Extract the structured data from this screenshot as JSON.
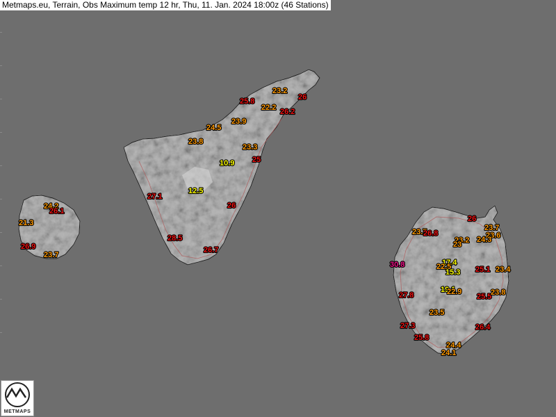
{
  "title": "Metmaps.eu, Terrain, Obs Maximum temp 12 hr, Thu, 11. Jan. 2024 18:00z (46 Stations)",
  "logo_text": "METMAPS",
  "colors": {
    "background": "#6e6e6e",
    "yellow": "#ffff00",
    "orange": "#ff9900",
    "red": "#ee1111",
    "magenta": "#ee1188"
  },
  "stations": [
    {
      "v": "23.2",
      "c": "orange"
    },
    {
      "v": "26",
      "c": "red"
    },
    {
      "v": "25.8",
      "c": "red"
    },
    {
      "v": "22.2",
      "c": "orange"
    },
    {
      "v": "26.2",
      "c": "red"
    },
    {
      "v": "24.5",
      "c": "orange"
    },
    {
      "v": "23.9",
      "c": "orange"
    },
    {
      "v": "23.8",
      "c": "orange"
    },
    {
      "v": "23.3",
      "c": "orange"
    },
    {
      "v": "10.9",
      "c": "yellow"
    },
    {
      "v": "25",
      "c": "red"
    },
    {
      "v": "12.5",
      "c": "yellow"
    },
    {
      "v": "27.1",
      "c": "red"
    },
    {
      "v": "26",
      "c": "red"
    },
    {
      "v": "28.5",
      "c": "red"
    },
    {
      "v": "26.7",
      "c": "red"
    },
    {
      "v": "24.2",
      "c": "orange"
    },
    {
      "v": "26.1",
      "c": "red"
    },
    {
      "v": "21.3",
      "c": "orange"
    },
    {
      "v": "26.9",
      "c": "red"
    },
    {
      "v": "23.7",
      "c": "orange"
    },
    {
      "v": "26",
      "c": "red"
    },
    {
      "v": "23.7",
      "c": "orange"
    },
    {
      "v": "23.6",
      "c": "orange"
    },
    {
      "v": "23.7",
      "c": "orange"
    },
    {
      "v": "26.8",
      "c": "red"
    },
    {
      "v": "23.2",
      "c": "orange"
    },
    {
      "v": "23",
      "c": "orange"
    },
    {
      "v": "24.3",
      "c": "orange"
    },
    {
      "v": "17.4",
      "c": "yellow"
    },
    {
      "v": "22.5",
      "c": "orange"
    },
    {
      "v": "15.3",
      "c": "yellow"
    },
    {
      "v": "30.8",
      "c": "magenta"
    },
    {
      "v": "25.1",
      "c": "red"
    },
    {
      "v": "23.4",
      "c": "orange"
    },
    {
      "v": "19.1",
      "c": "yellow"
    },
    {
      "v": "22.9",
      "c": "orange"
    },
    {
      "v": "27.8",
      "c": "red"
    },
    {
      "v": "25.5",
      "c": "red"
    },
    {
      "v": "23.8",
      "c": "orange"
    },
    {
      "v": "23.5",
      "c": "orange"
    },
    {
      "v": "27.3",
      "c": "red"
    },
    {
      "v": "26.4",
      "c": "red"
    },
    {
      "v": "25.8",
      "c": "red"
    },
    {
      "v": "24.4",
      "c": "orange"
    },
    {
      "v": "24.1",
      "c": "orange"
    }
  ]
}
